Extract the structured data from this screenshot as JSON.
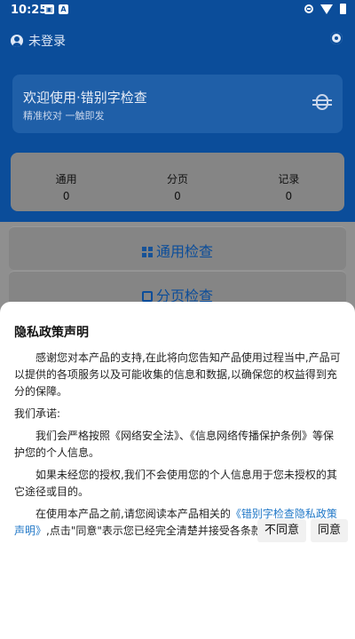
{
  "statusbar": {
    "time": "10:25",
    "icons": [
      "image-icon",
      "text-icon"
    ],
    "right_icons": [
      "do-not-disturb-icon",
      "wifi-icon",
      "battery-icon"
    ]
  },
  "header": {
    "login_text": "未登录",
    "settings_icon": "gear-icon"
  },
  "welcome": {
    "title": "欢迎使用·错别字检查",
    "subtitle": "精准校对 一触即发",
    "icon": "bug-icon"
  },
  "stats": [
    {
      "label": "通用",
      "value": "0"
    },
    {
      "label": "分页",
      "value": "0"
    },
    {
      "label": "记录",
      "value": "0"
    }
  ],
  "nav": [
    {
      "label": "通用检查",
      "icon": "grid-icon"
    },
    {
      "label": "分页检查",
      "icon": "page-icon"
    }
  ],
  "dialog": {
    "title": "隐私政策声明",
    "p1": "感谢您对本产品的支持,在此将向您告知产品使用过程当中,产品可以提供的各项服务以及可能收集的信息和数据,以确保您的权益得到充分的保障。",
    "p2": "我们承诺:",
    "p3": "我们会严格按照《网络安全法》、《信息网络传播保护条例》等保护您的个人信息。",
    "p4": "如果未经您的授权,我们不会使用您的个人信息用于您未授权的其它途径或目的。",
    "p5_prefix": "在使用本产品之前,请您阅读本产品相关的",
    "p5_link": "《错别字检查隐私政策声明》",
    "p5_suffix": ",点击\"同意\"表示您已经完全清楚并接受各条款。",
    "disagree_label": "不同意",
    "agree_label": "同意"
  },
  "colors": {
    "header": "#0b4d9a",
    "accent": "#1f77c7",
    "scrim_page": "#8f8f8f"
  }
}
